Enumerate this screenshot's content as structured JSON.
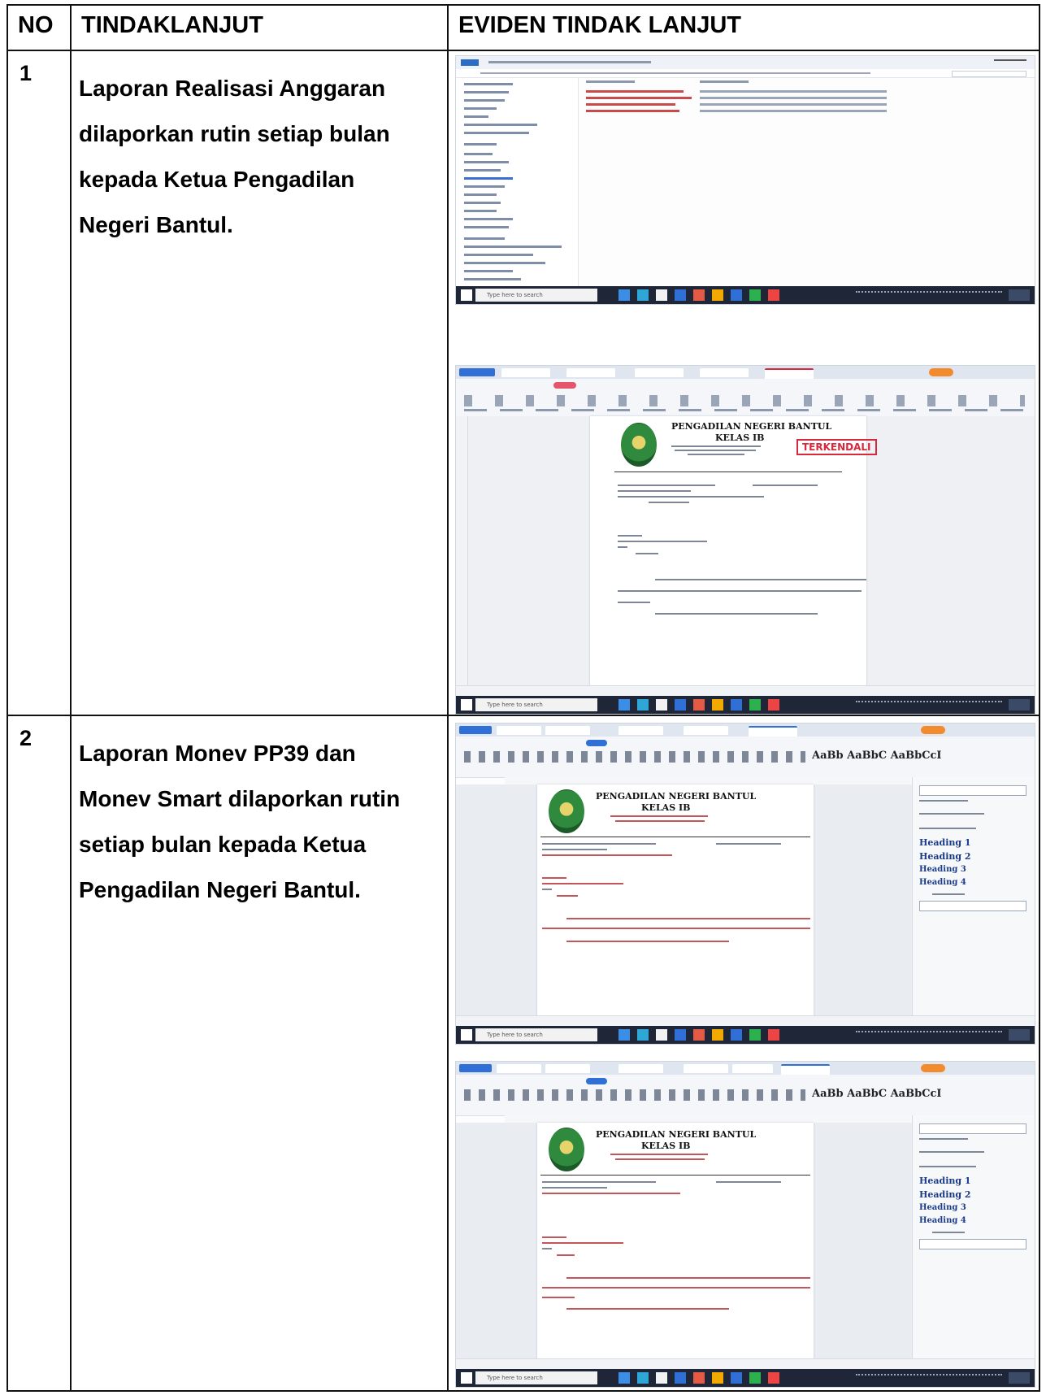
{
  "table": {
    "headers": [
      "NO",
      "TINDAKLANJUT",
      "EVIDEN TINDAK LANJUT"
    ],
    "rows": [
      {
        "no": "1",
        "text_lines": [
          "Laporan Realisasi Anggaran",
          "dilaporkan rutin setiap bulan",
          "kepada Ketua Pengadilan",
          "Negeri Bantul."
        ]
      },
      {
        "no": "2",
        "text_lines": [
          "Laporan Monev PP39 dan",
          "Monev Smart dilaporkan rutin",
          "setiap bulan kepada Ketua",
          "Pengadilan Negeri Bantul."
        ]
      }
    ]
  },
  "evidence": {
    "shot1": {
      "taskbar_search": "Type here to search"
    },
    "shot2": {
      "taskbar_search": "Type here to search",
      "letterhead_line1": "PENGADILAN NEGERI BANTUL",
      "letterhead_line2": "KELAS IB",
      "stamp": "TERKENDALI"
    },
    "shot3": {
      "taskbar_search": "Type here to search",
      "letterhead_line1": "PENGADILAN NEGERI BANTUL",
      "letterhead_line2": "KELAS IB",
      "styles": [
        "Heading 1",
        "Heading 2",
        "Heading 3",
        "Heading 4"
      ]
    },
    "shot4": {
      "taskbar_search": "Type here to search",
      "letterhead_line1": "PENGADILAN NEGERI BANTUL",
      "letterhead_line2": "KELAS IB",
      "styles": [
        "Heading 1",
        "Heading 2",
        "Heading 3",
        "Heading 4"
      ]
    }
  },
  "colors": {
    "border": "#111111",
    "stamp_red": "#d8283b",
    "taskbar": "#1e2637",
    "heading_blue": "#1a3a8a"
  }
}
